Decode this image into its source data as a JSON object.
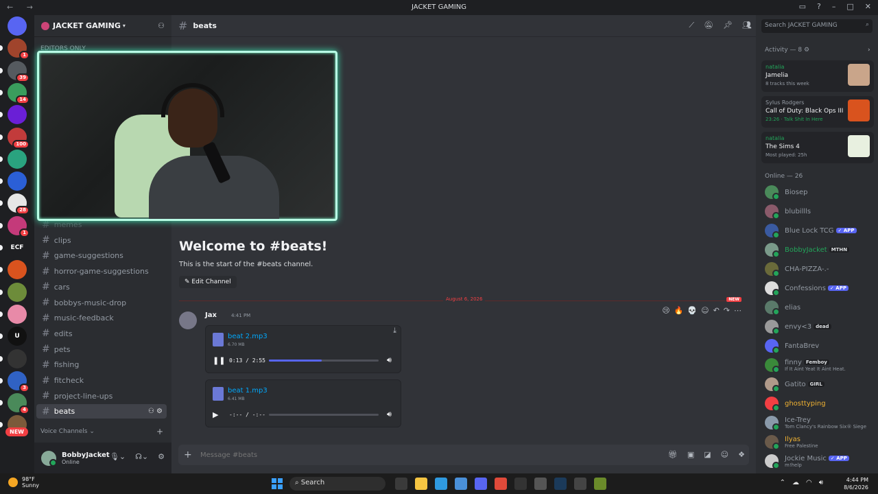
{
  "window": {
    "title": "JACKET GAMING",
    "nav": "← →"
  },
  "servers": {
    "items": [
      {
        "name": "discord-home",
        "label": "",
        "color": "#5865f2",
        "badge": ""
      },
      {
        "name": "server-1",
        "label": "",
        "color": "#a0442c",
        "badge": "1"
      },
      {
        "name": "server-2",
        "label": "",
        "color": "#555a5f",
        "badge": "39"
      },
      {
        "name": "server-3",
        "label": "",
        "color": "#3a9d5d",
        "badge": "14"
      },
      {
        "name": "server-4",
        "label": "",
        "color": "#6a1fd6",
        "badge": ""
      },
      {
        "name": "server-5",
        "label": "",
        "color": "#c23b3b",
        "badge": "100"
      },
      {
        "name": "server-6",
        "label": "",
        "color": "#2aa37f",
        "badge": ""
      },
      {
        "name": "server-7",
        "label": "",
        "color": "#2b5fd6",
        "badge": ""
      },
      {
        "name": "server-8",
        "label": "",
        "color": "#e6e6e6",
        "badge": "28"
      },
      {
        "name": "server-9",
        "label": "",
        "color": "#c43a7a",
        "badge": "1"
      },
      {
        "name": "server-ecf",
        "label": "ECF",
        "color": "#1e1f22",
        "badge": ""
      },
      {
        "name": "server-11",
        "label": "",
        "color": "#d9531e",
        "badge": ""
      },
      {
        "name": "server-12",
        "label": "",
        "color": "#6d8c3a",
        "badge": ""
      },
      {
        "name": "server-13",
        "label": "",
        "color": "#e88aa8",
        "badge": ""
      },
      {
        "name": "server-14",
        "label": "U",
        "color": "#111111",
        "badge": ""
      },
      {
        "name": "server-15",
        "label": "",
        "color": "#333333",
        "badge": ""
      },
      {
        "name": "server-16",
        "label": "",
        "color": "#3062c4",
        "badge": "3"
      },
      {
        "name": "server-17",
        "label": "",
        "color": "#4a8a5a",
        "badge": "4"
      },
      {
        "name": "server-18",
        "label": "",
        "color": "#7b5a3a",
        "badge": ""
      }
    ],
    "new_label": "NEW"
  },
  "guild": {
    "name": "JACKET GAMING",
    "category_top": "EDITORS ONLY"
  },
  "channels": [
    "memes",
    "clips",
    "game-suggestions",
    "horror-game-suggestions",
    "cars",
    "bobbys-music-drop",
    "music-feedback",
    "edits",
    "pets",
    "fishing",
    "fitcheck",
    "project-line-ups",
    "beats"
  ],
  "active_channel": "beats",
  "voice_category": "Voice Channels",
  "user": {
    "name": "BobbyJacket",
    "status": "Online"
  },
  "header": {
    "channel": "beats"
  },
  "welcome": {
    "title": "Welcome to #beats!",
    "subtitle": "This is the start of the #beats channel.",
    "edit_label": "Edit Channel"
  },
  "divider": {
    "date": "August 6, 2026",
    "new": "NEW"
  },
  "message": {
    "author": "Jax",
    "time": "4:41 PM"
  },
  "attachments": [
    {
      "file": "beat 2.mp3",
      "size": "6.70 MB",
      "time": "0:13 / 2:55",
      "progress": 0.48,
      "play_state": "pause"
    },
    {
      "file": "beat 1.mp3",
      "size": "6.41 MB",
      "time": "-:-- / -:--",
      "progress": 0,
      "play_state": "play"
    }
  ],
  "input": {
    "placeholder": "Message #beats"
  },
  "search": {
    "placeholder": "Search JACKET GAMING"
  },
  "activity": {
    "heading": "Activity — 8",
    "cards": [
      {
        "user": "natalia",
        "title": "Jamelia",
        "sub": "8 tracks this week",
        "thumb": "#c9a58a",
        "user_style": "green",
        "sub_style": ""
      },
      {
        "user": "Sylus Rodgers",
        "title": "Call of Duty: Black Ops III",
        "sub": "23:26 · Talk Shit In Here",
        "thumb": "#d9531e",
        "user_style": "grey",
        "sub_style": "green"
      },
      {
        "user": "natalia",
        "title": "The Sims 4",
        "sub": "Most played: 25h",
        "thumb": "#e8f0e0",
        "user_style": "green",
        "sub_style": ""
      }
    ]
  },
  "online": {
    "heading": "Online — 26",
    "members": [
      {
        "name": "Biosep",
        "status": "",
        "tag": "",
        "color": "#4a8a5a",
        "name_color": "#949ba4"
      },
      {
        "name": "blubillls",
        "status": "",
        "tag": "",
        "color": "#8a5a6a",
        "name_color": "#949ba4"
      },
      {
        "name": "Blue Lock TCG",
        "status": "",
        "tag": "✓ APP",
        "color": "#3a5aa0",
        "name_color": "#949ba4"
      },
      {
        "name": "BobbyJacket",
        "status": "",
        "tag": "MTHN",
        "color": "#7a9a8a",
        "name_color": "#23a55a"
      },
      {
        "name": "CHA-PIZZA-.-",
        "status": "",
        "tag": "",
        "color": "#6a6a3a",
        "name_color": "#949ba4"
      },
      {
        "name": "Confessions",
        "status": "",
        "tag": "✓ APP",
        "color": "#dddddd",
        "name_color": "#949ba4"
      },
      {
        "name": "elias",
        "status": "",
        "tag": "",
        "color": "#5a7a6a",
        "name_color": "#949ba4"
      },
      {
        "name": "envy<3",
        "status": "",
        "tag": "dead",
        "color": "#9a9a9a",
        "name_color": "#949ba4"
      },
      {
        "name": "FantaBrev",
        "status": "",
        "tag": "",
        "color": "#5865f2",
        "name_color": "#949ba4"
      },
      {
        "name": "finny",
        "status": "If It Aint Yeat It Aint Heat.",
        "tag": "Femboy",
        "color": "#3a8a3a",
        "name_color": "#949ba4"
      },
      {
        "name": "Gatito",
        "status": "",
        "tag": "GIRL",
        "color": "#b09a8a",
        "name_color": "#949ba4"
      },
      {
        "name": "ghosttyping",
        "status": "",
        "tag": "",
        "color": "#f23f43",
        "name_color": "#f0b232"
      },
      {
        "name": "Ice-Trey",
        "status": "Tom Clancy's Rainbow Six® Siege",
        "tag": "",
        "color": "#8a9aaa",
        "name_color": "#949ba4"
      },
      {
        "name": "Ilyas",
        "status": "Free Palestine",
        "tag": "",
        "color": "#6a5a4a",
        "name_color": "#f0b232"
      },
      {
        "name": "Jockie Music",
        "status": "m!help",
        "tag": "✓ APP",
        "color": "#cccccc",
        "name_color": "#949ba4"
      }
    ]
  },
  "taskbar": {
    "weather_temp": "98°F",
    "weather_desc": "Sunny",
    "search": "Search",
    "time": "4:44 PM",
    "date": "8/6/2026"
  }
}
